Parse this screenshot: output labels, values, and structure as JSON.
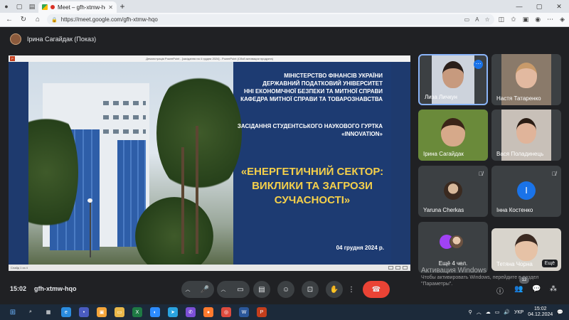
{
  "browser": {
    "tab_title": "Meet – gfh-xtmw-hqo",
    "url": "https://meet.google.com/gfh-xtmw-hqo"
  },
  "presenter": {
    "label": "Ірина Сагайдак (Показ)"
  },
  "slide": {
    "window_title": "Демонстрація PowerPoint - [засідання на 4 грудня 2024] - PowerPoint (Сбой активации продукта)",
    "ministry_lines": [
      "МІНІСТЕРСТВО ФІНАНСІВ УКРАЇНИ",
      "ДЕРЖАВНИЙ ПОДАТКОВИЙ УНІВЕРСИТЕТ",
      "ННІ ЕКОНОМІЧНОЇ БЕЗПЕКИ ТА МИТНОЇ СПРАВИ",
      "КАФЕДРА МИТНОЇ СПРАВИ ТА ТОВАРОЗНАВСТВА"
    ],
    "meeting_lines": [
      "ЗАСІДАННЯ СТУДЕНТСЬКОГО НАУКОВОГО ГУРТКА",
      "«INNOVATION»"
    ],
    "headline_lines": [
      "«ЕНЕРГЕТИЧНИЙ СЕКТОР:",
      "ВИКЛИКИ ТА ЗАГРОЗИ",
      "СУЧАСНОСТІ»"
    ],
    "date": "04 грудня 2024 р.",
    "status_text": "Слайд 1 из 4"
  },
  "participants": [
    {
      "name": "Лиза Личкун",
      "type": "video",
      "active": true,
      "skin": "#c79a7e",
      "hair": "#2a1f1a",
      "bg": "#cdd3dc"
    },
    {
      "name": "Настя Татаренко",
      "type": "video",
      "active": false,
      "skin": "#e2b9a0",
      "hair": "#c89a6a",
      "bg": "#8a7a6a"
    },
    {
      "name": "Ірина Сагайдак",
      "type": "video",
      "active": false,
      "skin": "#d6a98a",
      "hair": "#3a2418",
      "bg": "#6a8a3a"
    },
    {
      "name": "Вася Поладинець",
      "type": "video",
      "active": false,
      "skin": "#e0b49a",
      "hair": "#2a1c14",
      "bg": "#c8c0b8"
    },
    {
      "name": "Yaruna Cherkas",
      "type": "photo",
      "muted": true
    },
    {
      "name": "Інна Костенко",
      "type": "letter",
      "letter": "І",
      "muted": true
    },
    {
      "name": "Ещё 4 чел.",
      "type": "more"
    },
    {
      "name": "Тетяна Чорна",
      "type": "video",
      "active": false,
      "skin": "#e6c2a6",
      "hair": "#3b2a22",
      "bg": "#d8d4cc",
      "button": "Ещё"
    }
  ],
  "activation": {
    "title": "Активация Windows",
    "subtitle": "Чтобы активировать Windows, перейдите в раздел \"Параметры\"."
  },
  "meet_bar": {
    "time": "15:02",
    "code": "gfh-xtmw-hqo",
    "people_count": "12"
  },
  "taskbar": {
    "lang": "УКР",
    "time": "15:02",
    "date": "04.12.2024"
  },
  "colors": {
    "meet_bg": "#202124",
    "slide_bg": "#1d3b72",
    "headline": "#f5d04a",
    "end_call": "#ea4335",
    "active_border": "#8ab4f8"
  }
}
